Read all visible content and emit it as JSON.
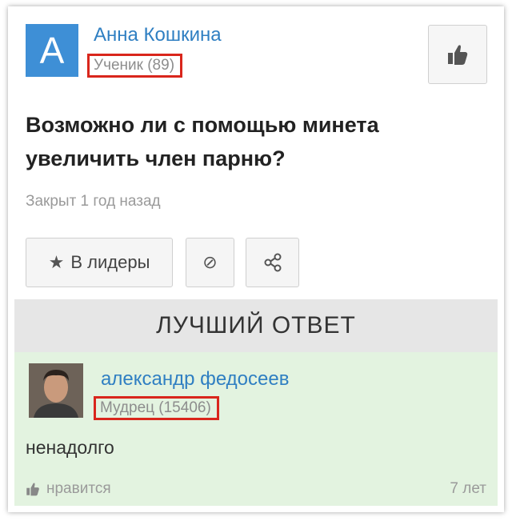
{
  "question": {
    "avatar_letter": "A",
    "author_name": "Анна Кошкина",
    "author_rank": "Ученик (89)",
    "text": "Возможно ли с помощью минета увеличить член парню?",
    "status": "Закрыт 1 год назад",
    "like_icon": "thumbs-up-icon"
  },
  "actions": {
    "leaders_icon": "★",
    "leaders_label": "В лидеры",
    "block_icon": "⊘"
  },
  "best_answer": {
    "header": "ЛУЧШИЙ ОТВЕТ",
    "author_name": "александр федосеев",
    "author_rank": "Мудрец (15406)",
    "text": "ненадолго",
    "likes_label": "нравится",
    "age": "7 лет"
  },
  "colors": {
    "accent": "#3e8fd6",
    "link": "#2f7fc2",
    "highlight_border": "#d9261c",
    "answer_bg": "#e3f3e0"
  }
}
